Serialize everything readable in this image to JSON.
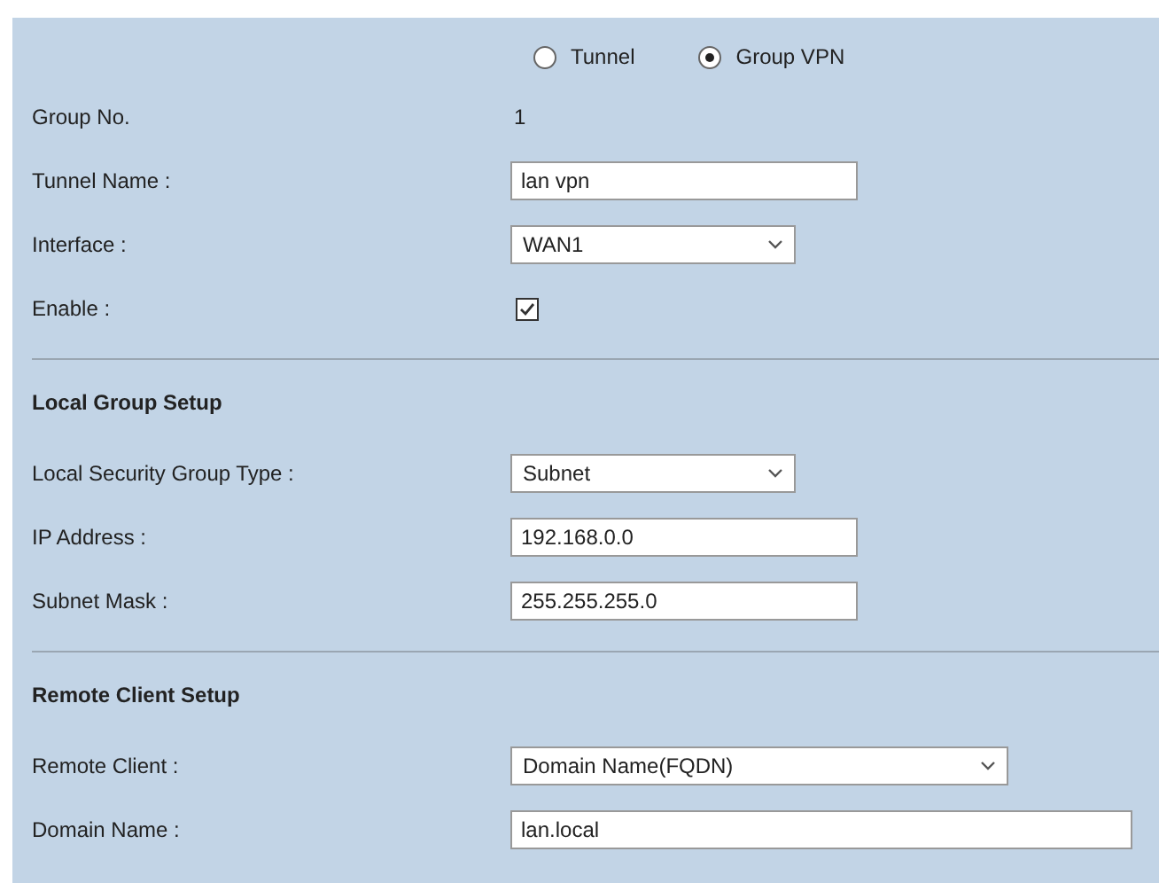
{
  "mode_options": [
    {
      "label": "Tunnel",
      "selected": false
    },
    {
      "label": "Group VPN",
      "selected": true
    }
  ],
  "sections": [
    {
      "rows": [
        {
          "kind": "text",
          "label": "Group No.",
          "value": "1"
        },
        {
          "kind": "input",
          "label": "Tunnel Name :",
          "value": "lan vpn"
        },
        {
          "kind": "select",
          "label": "Interface :",
          "value": "WAN1"
        },
        {
          "kind": "checkbox",
          "label": "Enable :",
          "checked": true
        }
      ]
    },
    {
      "heading": "Local Group Setup",
      "rows": [
        {
          "kind": "select",
          "label": "Local Security Group Type :",
          "value": "Subnet"
        },
        {
          "kind": "input",
          "label": "IP Address :",
          "value": "192.168.0.0"
        },
        {
          "kind": "input",
          "label": "Subnet Mask :",
          "value": "255.255.255.0"
        }
      ]
    },
    {
      "heading": "Remote Client Setup",
      "rows": [
        {
          "kind": "select-wide",
          "label": "Remote Client :",
          "value": "Domain Name(FQDN)"
        },
        {
          "kind": "input-wide",
          "label": "Domain Name :",
          "value": "lan.local"
        }
      ]
    }
  ]
}
